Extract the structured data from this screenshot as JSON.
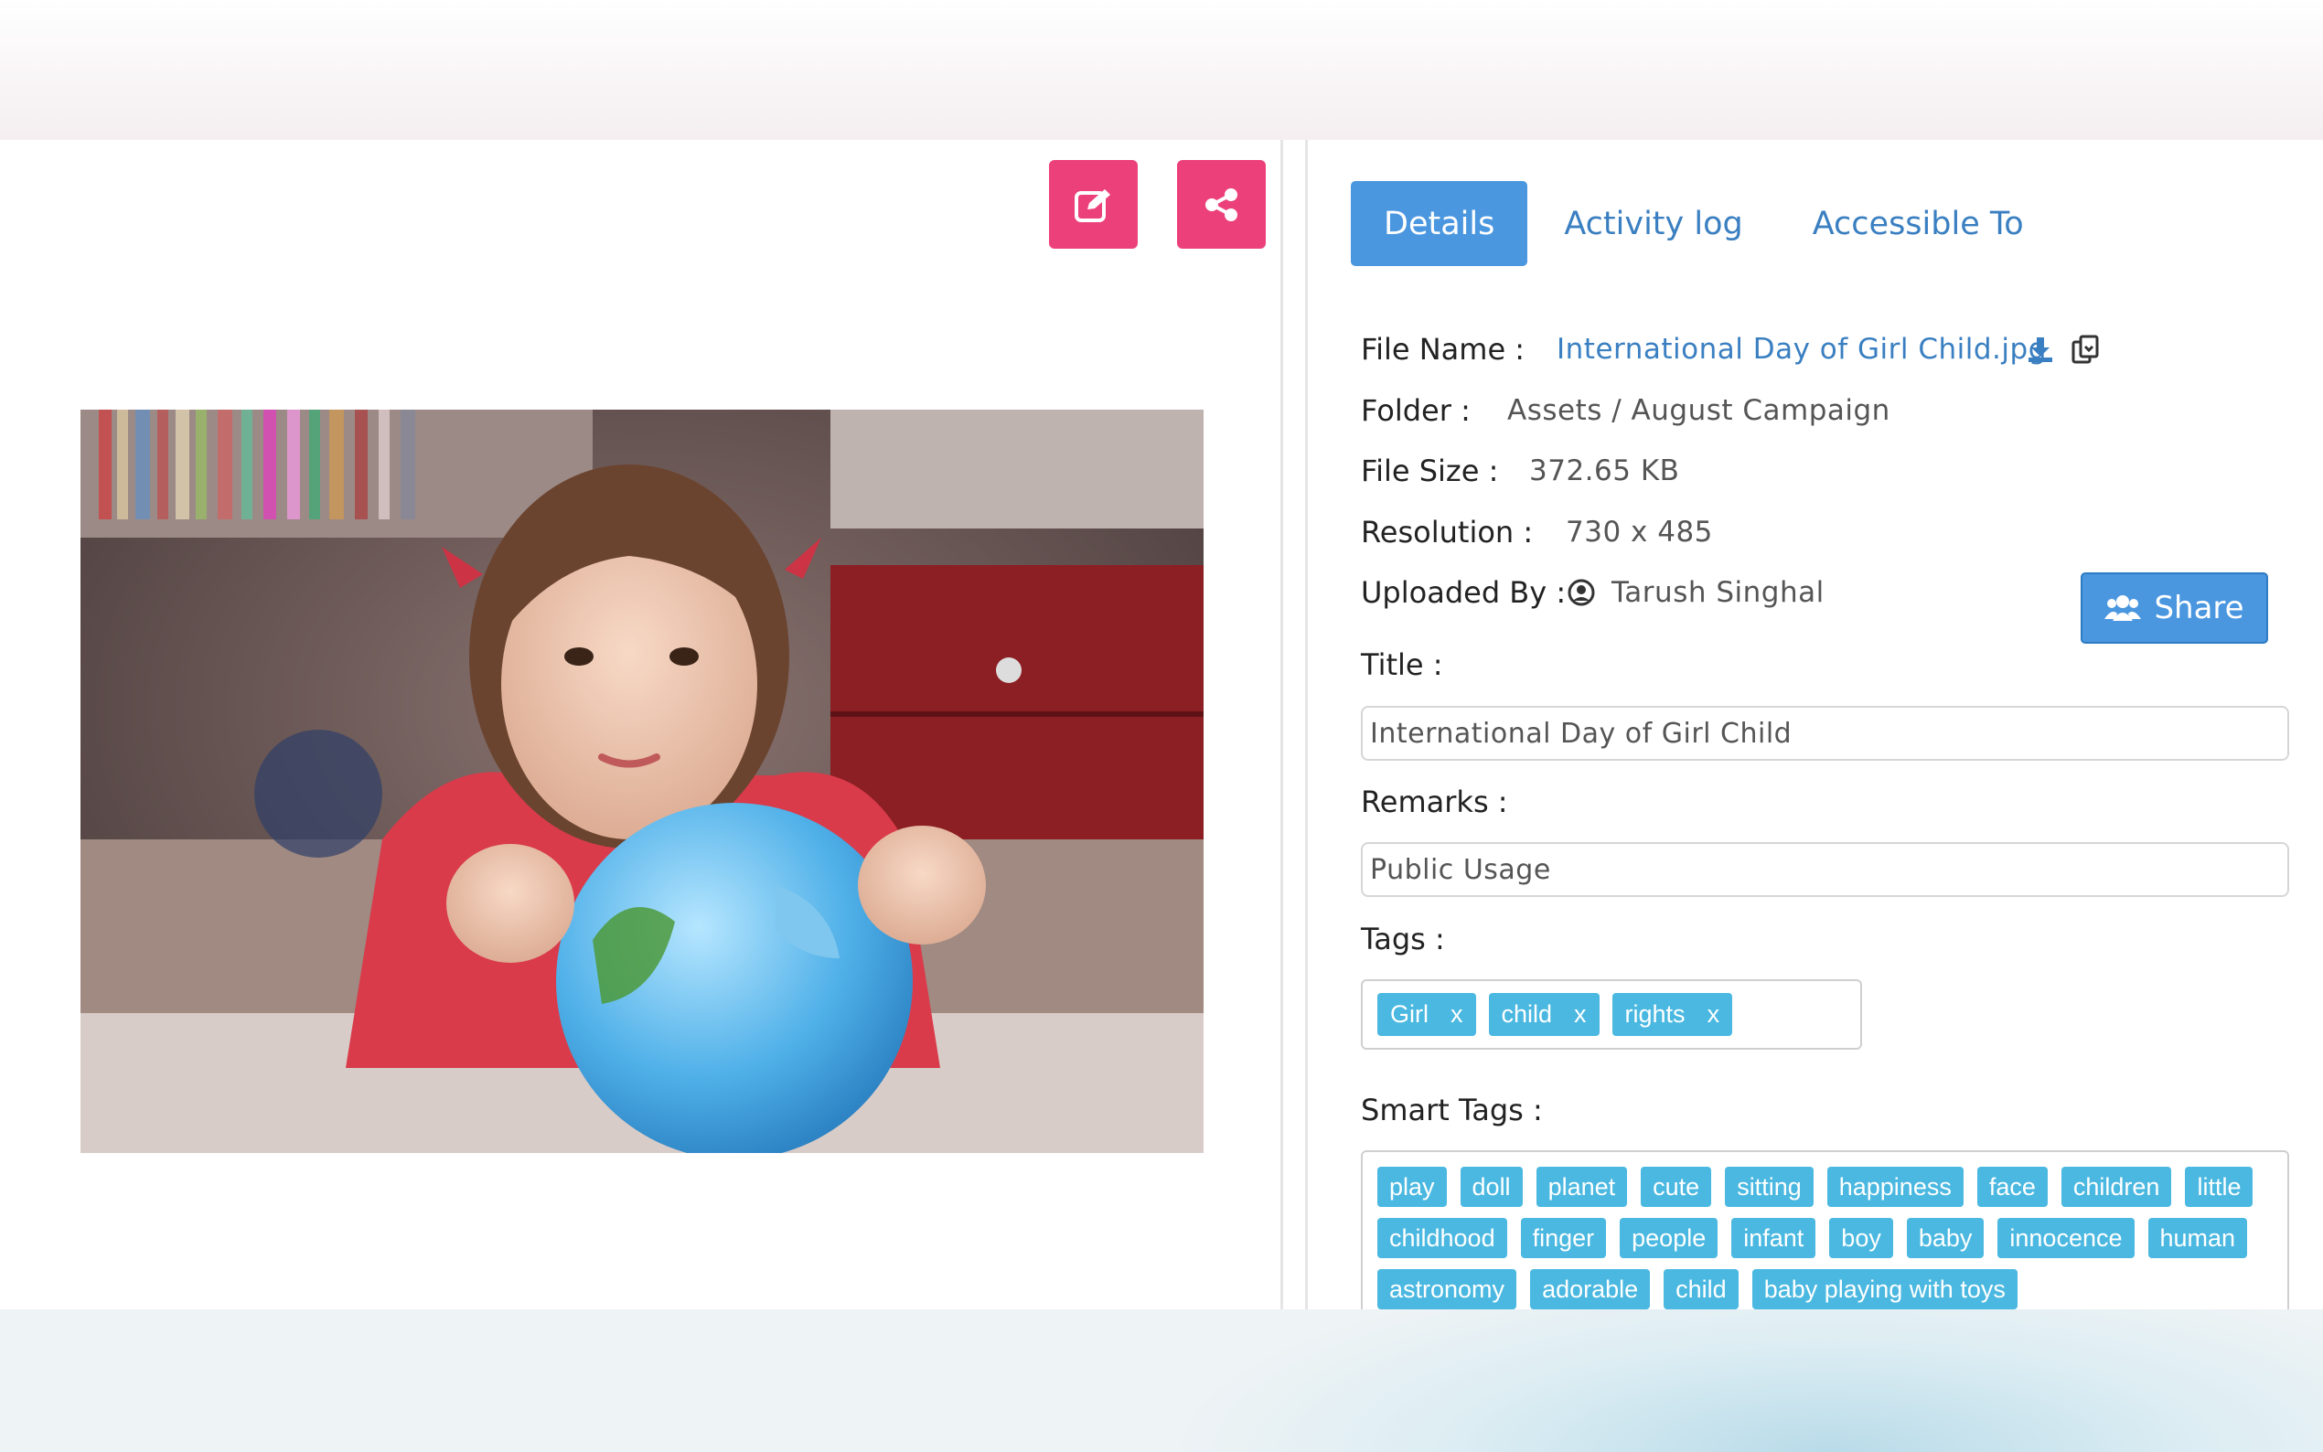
{
  "toolbar": {
    "edit_icon": "edit-icon",
    "share_icon": "share-icon"
  },
  "tabs": [
    {
      "label": "Details",
      "active": true
    },
    {
      "label": "Activity log",
      "active": false
    },
    {
      "label": "Accessible To",
      "active": false
    }
  ],
  "details": {
    "file_name_label": "File Name :",
    "file_name": "International Day of Girl Child.jpg",
    "folder_label": "Folder :",
    "folder": "Assets / August Campaign",
    "file_size_label": "File Size :",
    "file_size": "372.65 KB",
    "resolution_label": "Resolution :",
    "resolution": "730 x 485",
    "uploaded_by_label": "Uploaded By :",
    "uploaded_by": "Tarush Singhal",
    "share_button": "Share",
    "title_label": "Title :",
    "title_value": "International Day of Girl Child",
    "remarks_label": "Remarks :",
    "remarks_value": "Public Usage",
    "tags_label": "Tags :",
    "smart_tags_label": "Smart Tags :"
  },
  "tags": [
    "Girl",
    "child",
    "rights"
  ],
  "tag_remove": "x",
  "smart_tags": [
    "play",
    "doll",
    "planet",
    "cute",
    "sitting",
    "happiness",
    "face",
    "children",
    "little",
    "childhood",
    "finger",
    "people",
    "infant",
    "boy",
    "baby",
    "innocence",
    "human",
    "astronomy",
    "adorable",
    "child",
    "baby playing with toys"
  ],
  "colors": {
    "accent": "#4a97e0",
    "action": "#ec407a",
    "tag": "#4ab8e0",
    "link": "#3a7fc1"
  }
}
